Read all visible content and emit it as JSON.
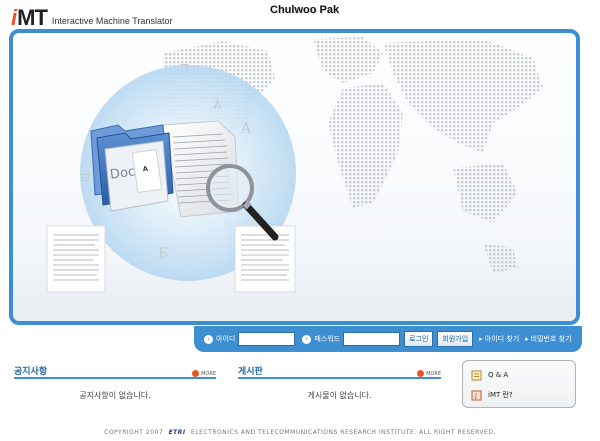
{
  "header": {
    "logo_prefix": "i",
    "logo_mt": "MT",
    "logo_subtitle": "Interactive Machine Translator",
    "user_name": "Chulwoo Pak"
  },
  "hero": {
    "folder_label": "Docs"
  },
  "login": {
    "id_label": "아이디",
    "password_label": "패스워드",
    "login_button": "로그인",
    "join_button": "회원가입",
    "find_id_link": "아이디 찾기",
    "find_password_link": "비밀번호 찾기"
  },
  "notice": {
    "title": "공지사항",
    "more": "MORE",
    "empty_text": "공지사항이 없습니다."
  },
  "bbs": {
    "title": "게시판",
    "more": "MORE",
    "empty_text": "게시물이 없습니다."
  },
  "side_menu": {
    "qna": "Q & A",
    "about": "iMT 란?"
  },
  "footer": {
    "copyright": "COPYRIGHT 2007",
    "org_logo": "ETRI",
    "org_name": "ELECTRONICS AND TELECOMMUNICATIONS RESEARCH INSTITUTE. ALL RIGHT RESERVED."
  },
  "colors": {
    "accent_blue": "#3e8fd1",
    "brand_orange": "#e8541e"
  }
}
